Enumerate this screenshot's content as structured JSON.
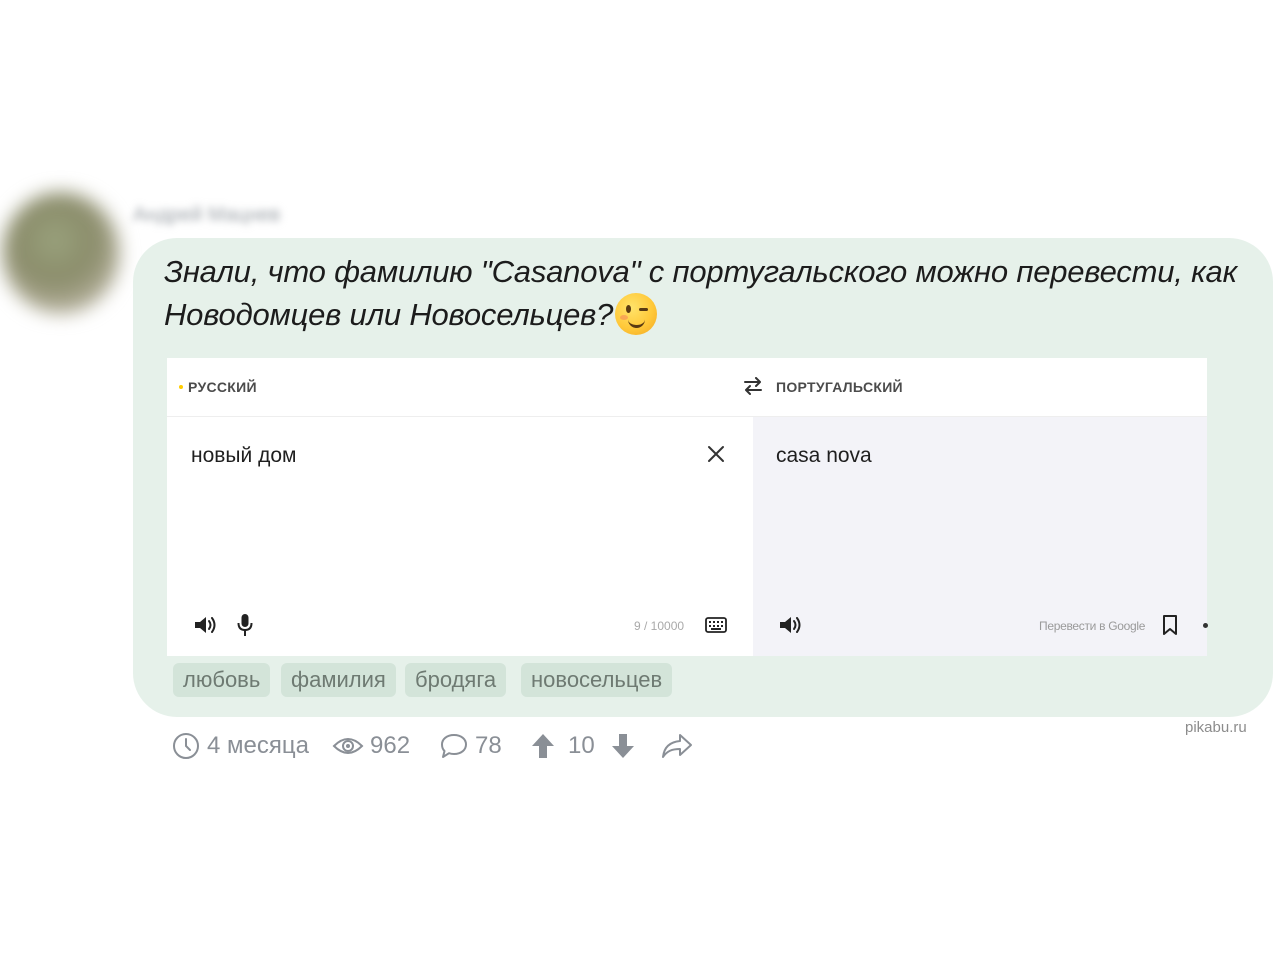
{
  "author": {
    "name": "Андрей Мацнев"
  },
  "post": {
    "text": "Знали, что фамилию \"Casanova\" с португальского можно перевести, как Новодомцев или Новосельцев?"
  },
  "translator": {
    "source_lang": "РУССКИЙ",
    "target_lang": "ПОРТУГАЛЬСКИЙ",
    "source_text": "новый дом",
    "target_text": "casa nova",
    "char_counter": "9 / 10000",
    "google_link": "Перевести в Google",
    "accent_color": "#ffcc00"
  },
  "tags": [
    "любовь",
    "фамилия",
    "бродяга",
    "новосельцев"
  ],
  "meta": {
    "time": "4 месяца",
    "views": "962",
    "comments": "78",
    "rating": "10"
  },
  "watermark": "pikabu.ru",
  "colors": {
    "bubble": "#e6f1ea",
    "tag_bg": "#d3e4d9"
  }
}
